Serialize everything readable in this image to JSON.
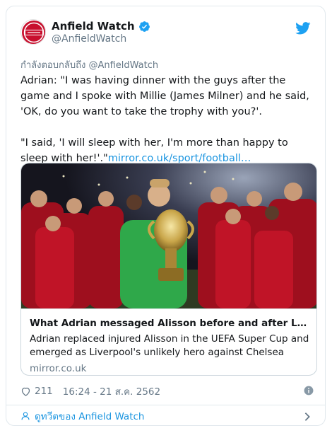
{
  "colors": {
    "accent": "#1b95e0",
    "muted": "#657786",
    "brand_red": "#c8102e"
  },
  "header": {
    "display_name": "Anfield Watch",
    "handle": "@AnfieldWatch",
    "avatar_text": "ANFIELD WATCH",
    "verified_icon": "verified-badge-icon",
    "logo_icon": "twitter-bird-icon"
  },
  "reply_to": {
    "prefix": "กำลังตอบกลับถึง",
    "mention": "@AnfieldWatch"
  },
  "tweet": {
    "paragraph1": "Adrian: \"I was having dinner with the guys after the game and I spoke with Millie (James Milner) and he said, 'OK, do you want to take the trophy with you?'.",
    "paragraph2": "\"I said, 'I will sleep with her, I'm more than happy to sleep with her!'.\"",
    "link_text": "mirror.co.uk/sport/football…"
  },
  "card": {
    "title": "What Adrian messaged Alisson before and after Liverpool's S...",
    "description": "Adrian replaced injured Alisson in the UEFA Super Cup and emerged as Liverpool's unlikely hero against Chelsea",
    "domain": "mirror.co.uk"
  },
  "footer": {
    "likes": "211",
    "timestamp": "16:24 - 21 ส.ค. 2562",
    "heart_icon": "heart-icon",
    "info_icon": "info-icon"
  },
  "view_profile": {
    "label": "ดูทวีตของ Anfield Watch",
    "icon": "user-icon"
  }
}
